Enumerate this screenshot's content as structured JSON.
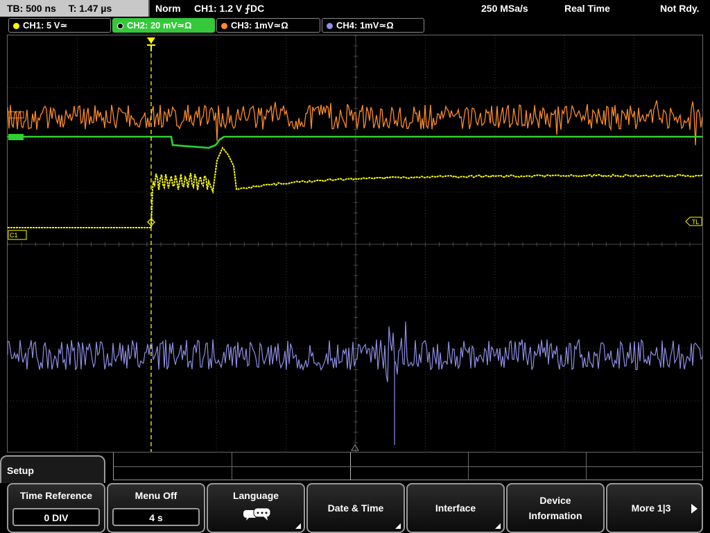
{
  "status": {
    "timebase": "TB: 500 ns",
    "trigger_time": "T: 1.47 µs",
    "mode": "Norm",
    "trigger_info": "CH1: 1.2 V ⨍DC",
    "sample_rate": "250 MSa/s",
    "acq_mode": "Real Time",
    "state": "Not Rdy."
  },
  "channels": [
    {
      "label": "CH1: 5 V≃",
      "color": "#ffff00",
      "active": false
    },
    {
      "label": "CH2: 20 mV≃Ω",
      "color": "#2fd12f",
      "active": true
    },
    {
      "label": "CH3: 1mV≃Ω",
      "color": "#ff8c2a",
      "active": false
    },
    {
      "label": "CH4: 1mV≃Ω",
      "color": "#8f8fe6",
      "active": false
    }
  ],
  "markers": {
    "ch1": "C1",
    "trigger_level": "TL"
  },
  "menu": {
    "title": "Setup",
    "time_reference_label": "Time Reference",
    "time_reference_value": "0 DIV",
    "menu_off_label": "Menu Off",
    "menu_off_value": "4 s",
    "language_label": "Language",
    "language_icon": "speech-bubble-icon",
    "date_time_label": "Date & Time",
    "interface_label": "Interface",
    "device_info_line1": "Device",
    "device_info_line2": "Information",
    "more_label": "More 1|3"
  }
}
